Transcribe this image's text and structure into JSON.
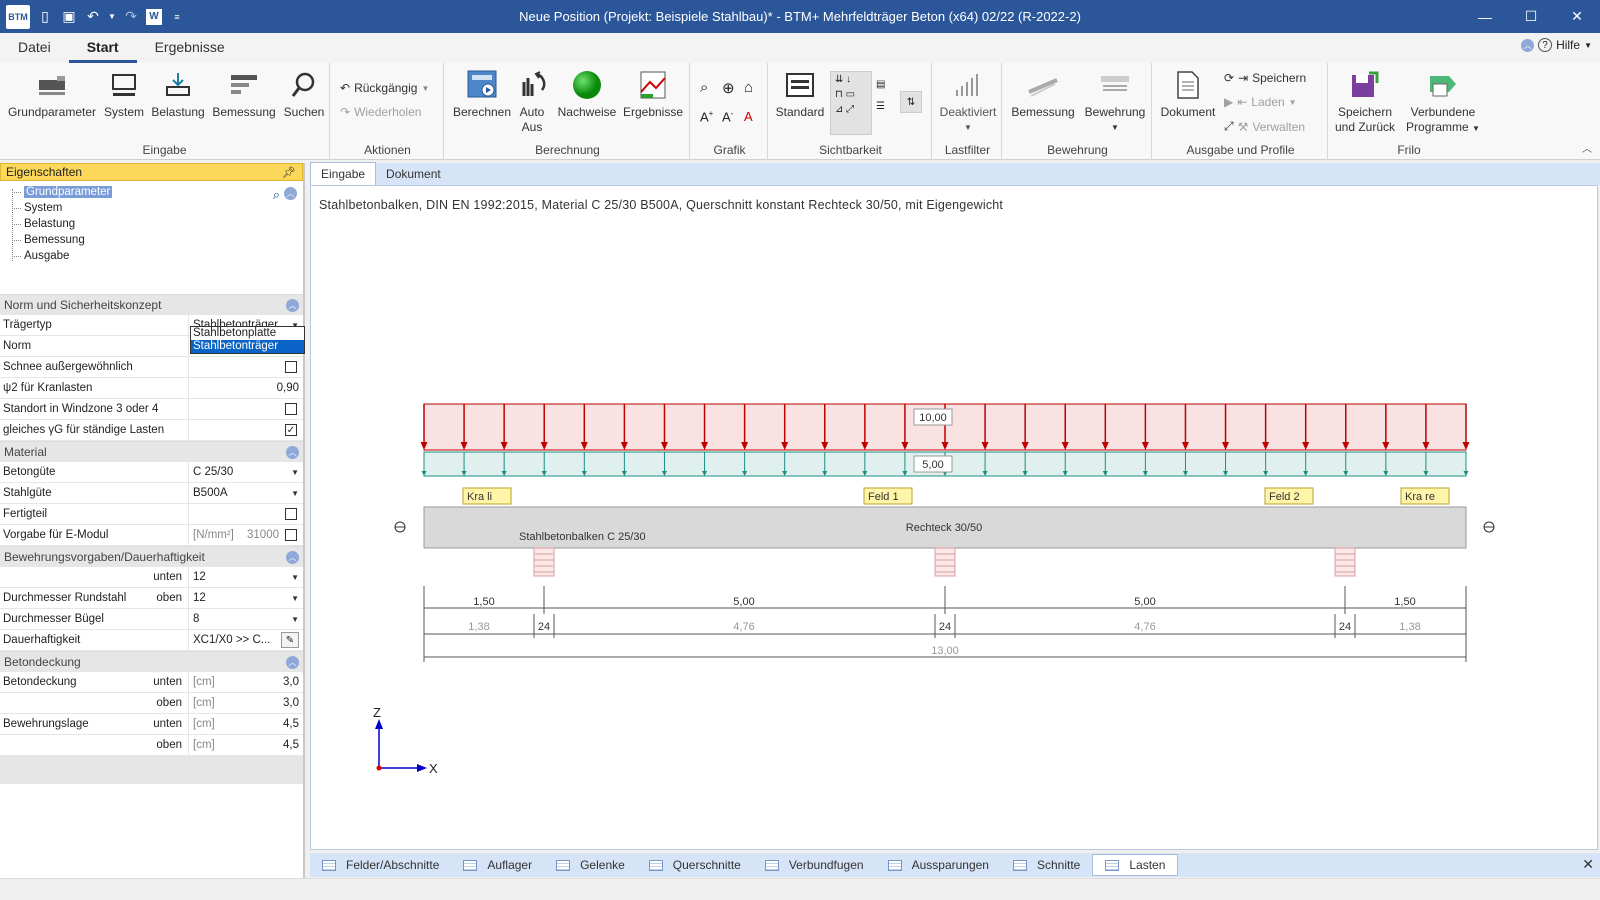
{
  "window": {
    "title": "Neue Position (Projekt: Beispiele Stahlbau)* - BTM+ Mehrfeldträger Beton (x64) 02/22 (R-2022-2)",
    "app_logo": "BTM",
    "minimize": "—",
    "maximize": "☐",
    "close": "✕"
  },
  "menu": {
    "tabs": [
      "Datei",
      "Start",
      "Ergebnisse"
    ],
    "active": "Start",
    "help": "Hilfe"
  },
  "ribbon": {
    "groups": {
      "eingabe": "Eingabe",
      "aktionen": "Aktionen",
      "berechnung": "Berechnung",
      "grafik": "Grafik",
      "sichtbarkeit": "Sichtbarkeit",
      "lastfilter": "Lastfilter",
      "bewehrung": "Bewehrung",
      "ausgabe": "Ausgabe und Profile",
      "frilo": "Frilo"
    },
    "buttons": {
      "grundparameter": "Grundparameter",
      "system": "System",
      "belastung": "Belastung",
      "bemessung": "Bemessung",
      "suchen": "Suchen",
      "rueckgaengig": "Rückgängig",
      "wiederholen": "Wiederholen",
      "berechnen": "Berechnen",
      "auto_line1": "Auto",
      "auto_line2": "Aus",
      "nachweise": "Nachweise",
      "ergebnisse": "Ergebnisse",
      "standard": "Standard",
      "deaktiviert": "Deaktiviert",
      "bemessung2": "Bemessung",
      "bewehrung": "Bewehrung",
      "dokument": "Dokument",
      "speichern": "Speichern",
      "laden": "Laden",
      "verwalten": "Verwalten",
      "speichern_zurueck_1": "Speichern",
      "speichern_zurueck_2": "und Zurück",
      "verbundene_1": "Verbundene",
      "verbundene_2": "Programme"
    }
  },
  "panel": {
    "title": "Eigenschaften",
    "tree": [
      "Grundparameter",
      "System",
      "Belastung",
      "Bemessung",
      "Ausgabe"
    ],
    "tree_selected": "Grundparameter",
    "sections": {
      "norm": {
        "title": "Norm und Sicherheitskonzept",
        "traegertyp_label": "Trägertyp",
        "traegertyp_value": "Stahlbetonträger",
        "norm_label": "Norm",
        "schnee_label": "Schnee außergewöhnlich",
        "psi_label": "ψ2 für Kranlasten",
        "psi_value": "0,90",
        "windzone_label": "Standort in Windzone 3 oder 4",
        "gammag_label": "gleiches γG für ständige Lasten"
      },
      "material": {
        "title": "Material",
        "beton_label": "Betongüte",
        "beton_value": "C 25/30",
        "stahl_label": "Stahlgüte",
        "stahl_value": "B500A",
        "fertigteil_label": "Fertigteil",
        "emodul_label": "Vorgabe für E-Modul",
        "emodul_unit": "[N/mm²]",
        "emodul_value": "31000"
      },
      "bewehrung": {
        "title": "Bewehrungsvorgaben/Dauerhaftigkeit",
        "unten_sub": "unten",
        "unten_value": "12",
        "rundstahl_label": "Durchmesser Rundstahl",
        "oben_sub": "oben",
        "oben_value": "12",
        "buegel_label": "Durchmesser Bügel",
        "buegel_value": "8",
        "dauer_label": "Dauerhaftigkeit",
        "dauer_value": "XC1/X0  >> C..."
      },
      "betondeckung": {
        "title": "Betondeckung",
        "deckung_label": "Betondeckung",
        "unten_sub": "unten",
        "oben_sub": "oben",
        "unit": "[cm]",
        "deckung_unten": "3,0",
        "deckung_oben": "3,0",
        "lage_label": "Bewehrungslage",
        "lage_unten": "4,5",
        "lage_oben": "4,5"
      }
    },
    "dropdown_options": [
      "Stahlbetonplatte",
      "Stahlbetonträger"
    ],
    "dropdown_selected": "Stahlbetonträger"
  },
  "doc_tabs": [
    "Eingabe",
    "Dokument"
  ],
  "doc_tab_active": "Eingabe",
  "drawing": {
    "description": "Stahlbetonbalken, DIN EN 1992:2015, Material C 25/30 B500A, Querschnitt konstant Rechteck 30/50, mit Eigengewicht",
    "load_top": "10,00",
    "load_bottom": "5,00",
    "tag_kra_li": "Kra li",
    "tag_feld1": "Feld 1",
    "tag_feld2": "Feld 2",
    "tag_kra_re": "Kra re",
    "beam_left": "Stahlbetonbalken C 25/30",
    "beam_center": "Rechteck 30/50",
    "dims_row1": [
      "1,50",
      "5,00",
      "5,00",
      "1,50"
    ],
    "dims_row2": [
      "1,38",
      "24",
      "4,76",
      "24",
      "4,76",
      "24",
      "1,38"
    ],
    "dim_total": "13,00",
    "axis_z": "Z",
    "axis_x": "X",
    "colors": {
      "load_red": "#c00000",
      "load_fill": "#f9e2e2",
      "self_weight": "#1a9080",
      "self_fill": "#dff0ef",
      "beam": "#d9d9d9",
      "tag": "#fff5a8"
    }
  },
  "bottom_tabs": [
    "Felder/Abschnitte",
    "Auflager",
    "Gelenke",
    "Querschnitte",
    "Verbundfugen",
    "Aussparungen",
    "Schnitte",
    "Lasten"
  ],
  "bottom_tab_active": "Lasten"
}
